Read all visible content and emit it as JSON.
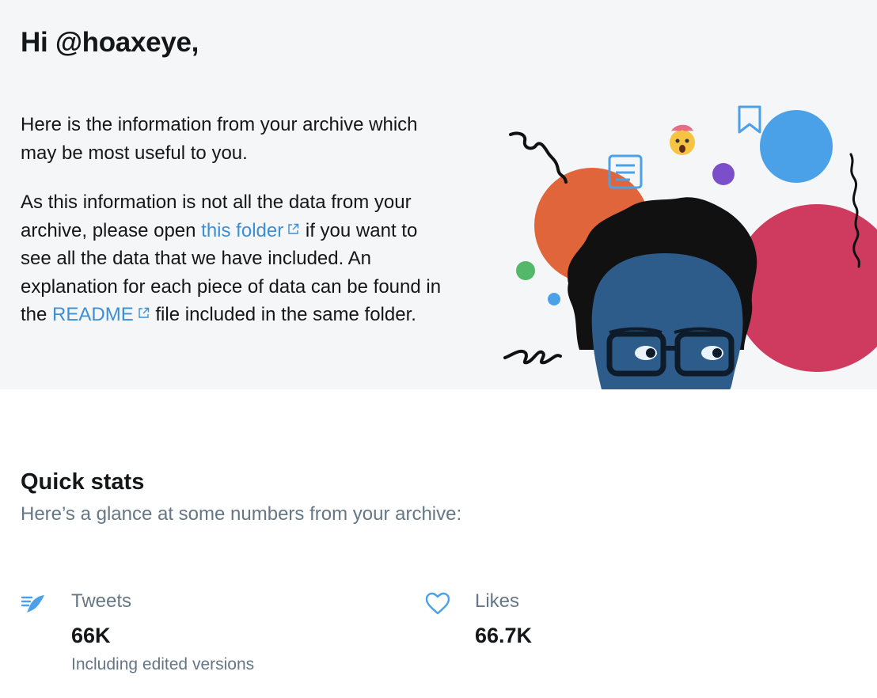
{
  "header": {
    "greeting": "Hi @hoaxeye,"
  },
  "intro": {
    "paragraph1": "Here is the information from your archive which may be most useful to you.",
    "paragraph2_part1": "As this information is not all the data from your archive, please open ",
    "folder_link": "this folder",
    "paragraph2_part2": " if you want to see all the data that we have included. An explanation for each piece of data can be found in the ",
    "readme_link": "README",
    "paragraph2_part3": " file included in the same folder."
  },
  "quick_stats": {
    "title": "Quick stats",
    "subtitle": "Here’s a glance at some numbers from your archive:",
    "tweets": {
      "label": "Tweets",
      "value": "66K",
      "note": "Including edited versions",
      "icon": "quill-icon"
    },
    "likes": {
      "label": "Likes",
      "value": "66.7K",
      "icon": "heart-icon"
    }
  },
  "colors": {
    "hero_background": "#f5f6f7",
    "link": "#3b8fd6",
    "muted_text": "#657786",
    "orange_circle": "#e1653a",
    "red_circle": "#cf3a5f",
    "blue_circle": "#4ba1e8",
    "purple_dot": "#7b4fc9",
    "green_dot": "#53b86a"
  }
}
